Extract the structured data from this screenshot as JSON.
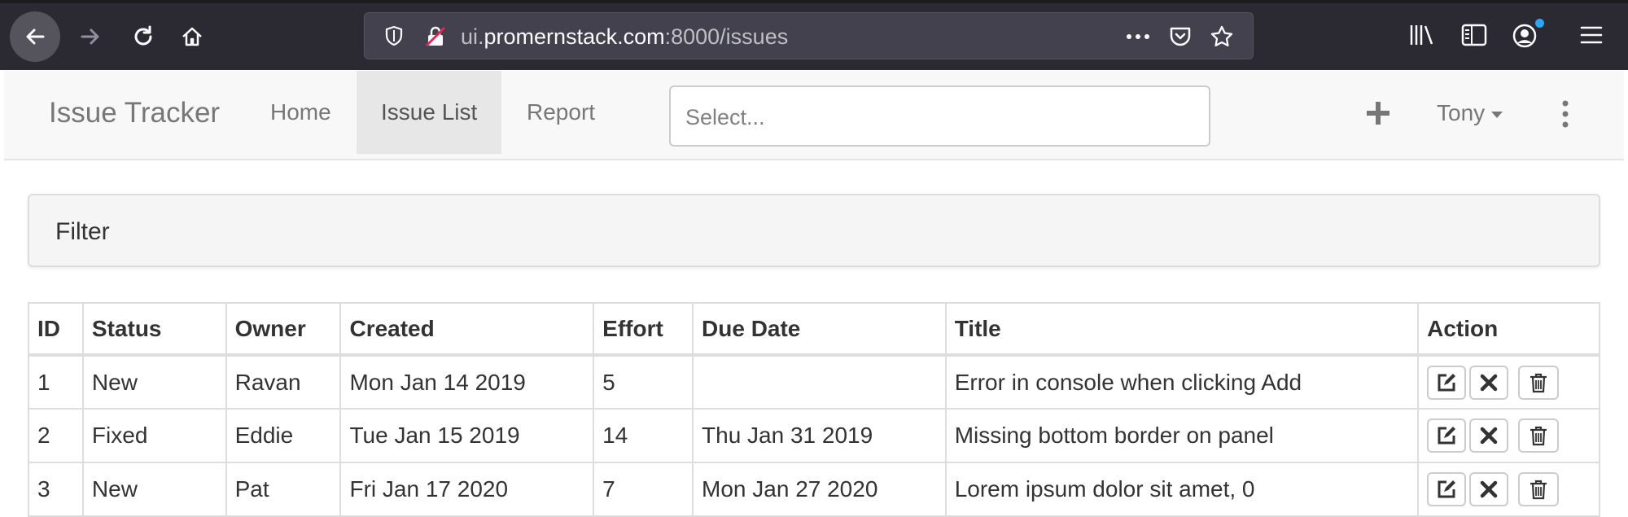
{
  "browser": {
    "url_prefix": "ui.",
    "url_host": "promernstack.com",
    "url_rest": ":8000/issues",
    "icons": [
      "back-icon",
      "forward-icon",
      "reload-icon",
      "home-icon",
      "shield-icon",
      "insecure-lock-icon",
      "more-icon",
      "pocket-icon",
      "star-icon",
      "library-icon",
      "sidebar-icon",
      "account-icon",
      "hamburger-menu-icon"
    ]
  },
  "navbar": {
    "brand": "Issue Tracker",
    "links": [
      {
        "label": "Home"
      },
      {
        "label": "Issue List",
        "active": true
      },
      {
        "label": "Report"
      }
    ],
    "search_placeholder": "Select...",
    "user": "Tony"
  },
  "filter": {
    "title": "Filter"
  },
  "table": {
    "headers": [
      "ID",
      "Status",
      "Owner",
      "Created",
      "Effort",
      "Due Date",
      "Title",
      "Action"
    ],
    "rows": [
      {
        "id": "1",
        "status": "New",
        "owner": "Ravan",
        "created": "Mon Jan 14 2019",
        "effort": "5",
        "due": "",
        "title": "Error in console when clicking Add"
      },
      {
        "id": "2",
        "status": "Fixed",
        "owner": "Eddie",
        "created": "Tue Jan 15 2019",
        "effort": "14",
        "due": "Thu Jan 31 2019",
        "title": "Missing bottom border on panel"
      },
      {
        "id": "3",
        "status": "New",
        "owner": "Pat",
        "created": "Fri Jan 17 2020",
        "effort": "7",
        "due": "Mon Jan 27 2020",
        "title": "Lorem ipsum dolor sit amet, 0"
      }
    ]
  },
  "colors": {
    "chrome_bg": "#2b2a33",
    "navbar_bg": "#f8f8f8",
    "active_nav_bg": "#e7e7e7",
    "panel_bg": "#f5f5f5"
  }
}
